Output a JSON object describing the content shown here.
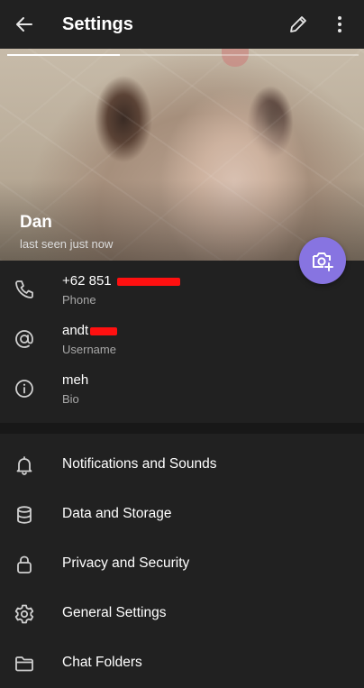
{
  "header": {
    "title": "Settings",
    "icons": {
      "back": "arrow-left-icon",
      "edit": "pencil-icon",
      "more": "more-vertical-icon"
    }
  },
  "profile": {
    "name": "Dan",
    "status": "last seen just now",
    "story_progress": 0.32
  },
  "fab": {
    "icon": "camera-add-icon",
    "color": "#8774e1"
  },
  "info": [
    {
      "icon": "phone-icon",
      "value": "+62 851",
      "label": "Phone"
    },
    {
      "icon": "at-icon",
      "value": "andt",
      "label": "Username"
    },
    {
      "icon": "info-icon",
      "value": "meh",
      "label": "Bio"
    }
  ],
  "menu": [
    {
      "icon": "bell-icon",
      "label": "Notifications and Sounds"
    },
    {
      "icon": "database-icon",
      "label": "Data and Storage"
    },
    {
      "icon": "lock-icon",
      "label": "Privacy and Security"
    },
    {
      "icon": "gear-icon",
      "label": "General Settings"
    },
    {
      "icon": "folder-icon",
      "label": "Chat Folders"
    }
  ],
  "colors": {
    "background": "#212121",
    "accent": "#8774e1",
    "redaction": "#ff1010",
    "secondary_text": "#a8a8a8"
  }
}
